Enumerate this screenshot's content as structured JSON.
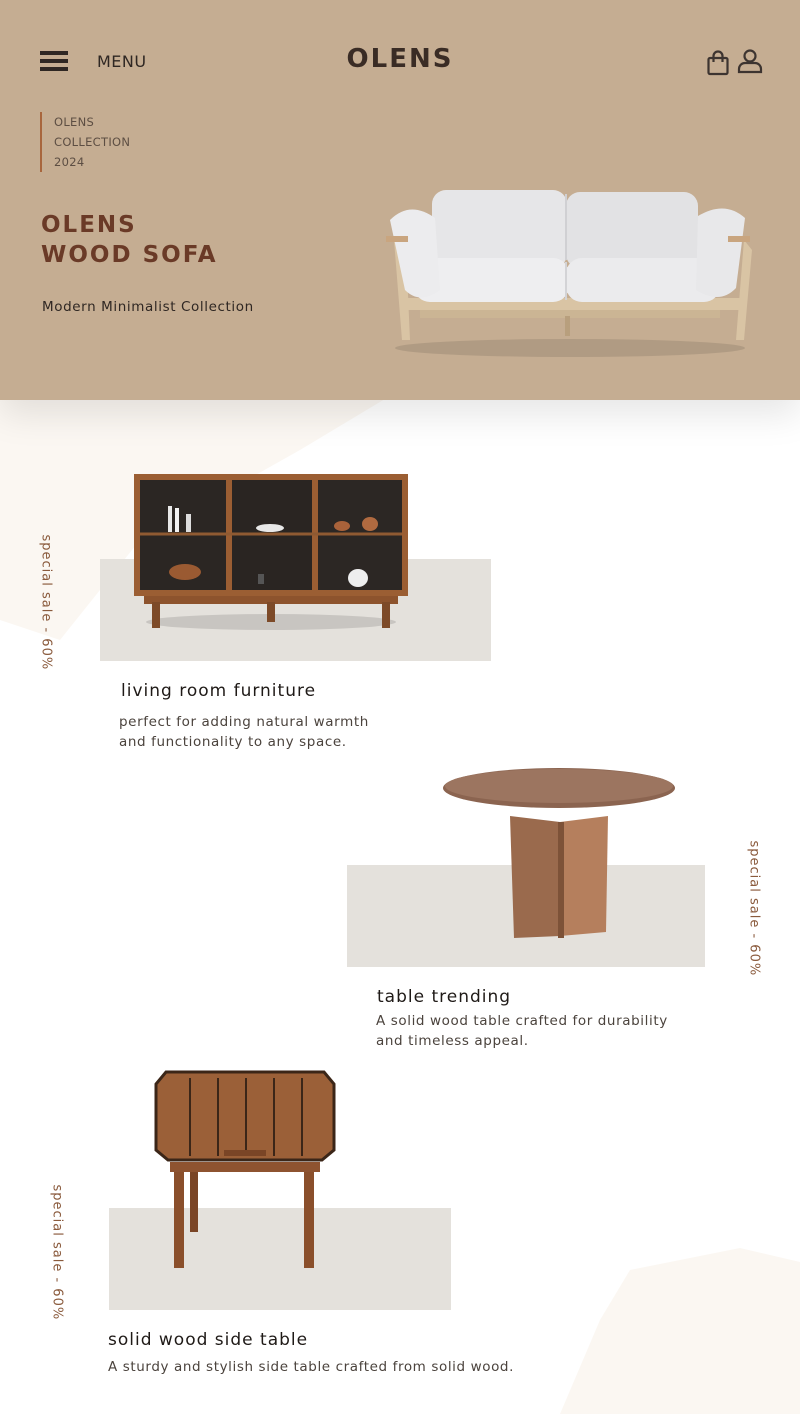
{
  "header": {
    "menu_label": "MENU",
    "logo": "OLENS",
    "icons": [
      "menu-icon",
      "shopping-bag-icon",
      "user-icon"
    ]
  },
  "hero": {
    "collection_lines": [
      "OLENS",
      "COLLECTION",
      "2024"
    ],
    "title_line1": "OLENS",
    "title_line2": "WOOD SOFA",
    "subtitle": "Modern Minimalist Collection"
  },
  "products": [
    {
      "title": "living room furniture",
      "desc_line1": "perfect for adding natural warmth",
      "desc_line2": "and functionality to any space.",
      "badge": "special sale - 60%"
    },
    {
      "title": "table trending",
      "desc_line1": "A solid wood table crafted for durability",
      "desc_line2": "and timeless appeal.",
      "badge": "special sale - 60%"
    },
    {
      "title": "solid wood side table",
      "desc_line1": "A sturdy and stylish side table crafted from solid wood.",
      "badge": "special sale - 60%"
    }
  ],
  "colors": {
    "hero_bg": "#c5ad92",
    "accent": "#6a3a27",
    "panel": "#e4e1dc",
    "blob": "#fbf7f2"
  }
}
